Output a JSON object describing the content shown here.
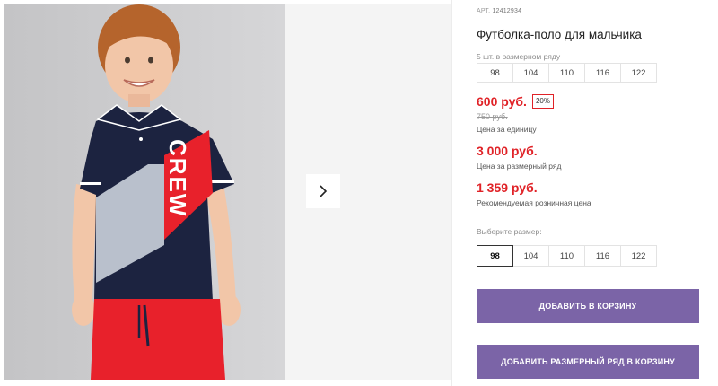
{
  "product": {
    "article_label": "АРТ.",
    "article_number": "12412934",
    "title": "Футболка-поло для мальчика",
    "series_note": "5 шт. в размерном ряду",
    "series_sizes": [
      "98",
      "104",
      "110",
      "116",
      "122"
    ]
  },
  "pricing": {
    "price": "600 руб.",
    "discount": "20%",
    "old_price": "750 руб.",
    "unit_label": "Цена за единицу",
    "series_price": "3 000 руб.",
    "series_label": "Цена за размерный ряд",
    "rrp_price": "1 359 руб.",
    "rrp_label": "Рекомендуемая розничная цена"
  },
  "size_select": {
    "label": "Выберите размер:",
    "options": [
      "98",
      "104",
      "110",
      "116",
      "122"
    ],
    "selected": "98"
  },
  "actions": {
    "add_to_cart": "ДОБАВИТЬ В КОРЗИНУ",
    "add_series_to_cart": "ДОБАВИТЬ РАЗМЕРНЫЙ РЯД В КОРЗИНУ"
  },
  "gallery": {
    "shirt_print": "CREW",
    "next_icon": "chevron-right-icon"
  },
  "colors": {
    "accent_red": "#e02227",
    "button_purple": "#7b64a7",
    "navy": "#1c2340",
    "shirt_red": "#e8212b"
  }
}
